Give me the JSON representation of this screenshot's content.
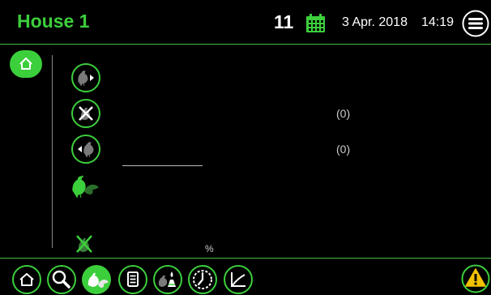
{
  "header": {
    "title": "House 1",
    "day_number": "11",
    "date": "3 Apr. 2018",
    "time": "14:19"
  },
  "rows": {
    "cull_value": "(0)",
    "move_in_value": "(0)",
    "percent_unit": "%"
  },
  "colors": {
    "accent": "#3ccf3c",
    "background": "#000000",
    "warning": "#f2c200"
  },
  "icons": {
    "header": [
      "calendar-icon",
      "menu-icon"
    ],
    "side": [
      "home-icon"
    ],
    "rows": [
      "bird-out-icon",
      "bird-cull-icon",
      "bird-in-icon",
      "flock-icon",
      "flock-crossed-icon"
    ],
    "tabs": [
      "home-icon",
      "search-icon",
      "flock-icon",
      "report-icon",
      "water-feed-icon",
      "clock-icon",
      "chart-icon"
    ],
    "alarm": "alarm-warning-icon"
  }
}
